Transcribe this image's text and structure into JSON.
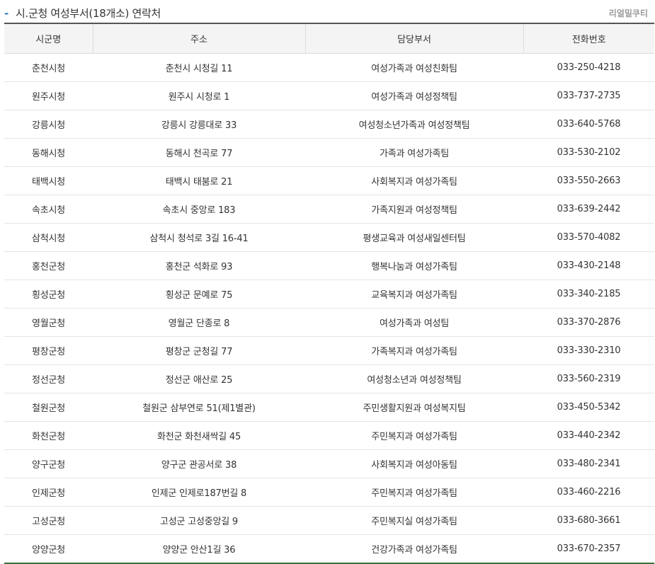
{
  "header": {
    "dash": "-",
    "title": "시.군청 여성부서(18개소) 연락처",
    "watermark": "리얼밀쿠티"
  },
  "table": {
    "columns": [
      "시군명",
      "주소",
      "담당부서",
      "전화번호"
    ],
    "rows": [
      [
        "춘천시청",
        "춘천시 시청길 11",
        "여성가족과 여성친화팀",
        "033-250-4218"
      ],
      [
        "원주시청",
        "원주시 시청로 1",
        "여성가족과 여성정책팀",
        "033-737-2735"
      ],
      [
        "강릉시청",
        "강릉시 강릉대로 33",
        "여성청소년가족과 여성정책팀",
        "033-640-5768"
      ],
      [
        "동해시청",
        "동해시 천곡로 77",
        "가족과 여성가족팀",
        "033-530-2102"
      ],
      [
        "태백시청",
        "태백시 태붐로 21",
        "사회복지과 여성가족팀",
        "033-550-2663"
      ],
      [
        "속초시청",
        "속초시 중앙로 183",
        "가족지원과 여성정책팀",
        "033-639-2442"
      ],
      [
        "삼척시청",
        "삼척시 청석로 3길 16-41",
        "평생교육과 여성새일센터팀",
        "033-570-4082"
      ],
      [
        "홍천군청",
        "홍천군 석화로 93",
        "행복나눔과 여성가족팀",
        "033-430-2148"
      ],
      [
        "횡성군청",
        "횡성군 문예로 75",
        "교육복지과 여성가족팀",
        "033-340-2185"
      ],
      [
        "영월군청",
        "영월군 단종로 8",
        "여성가족과 여성팀",
        "033-370-2876"
      ],
      [
        "평창군청",
        "평창군 군청길 77",
        "가족복지과 여성가족팀",
        "033-330-2310"
      ],
      [
        "정선군청",
        "정선군 애산로 25",
        "여성청소년과 여성정책팀",
        "033-560-2319"
      ],
      [
        "철원군청",
        "철원군 삼부연로 51(제1별관)",
        "주민생활지원과 여성복지팀",
        "033-450-5342"
      ],
      [
        "화천군청",
        "화천군 화천새싹길 45",
        "주민복지과 여성가족팀",
        "033-440-2342"
      ],
      [
        "양구군청",
        "양구군 관공서로 38",
        "사회복지과 여성아동팀",
        "033-480-2341"
      ],
      [
        "인제군청",
        "인제군 인제로187번길 8",
        "주민복지과 여성가족팀",
        "033-460-2216"
      ],
      [
        "고성군청",
        "고성군 고성중앙길 9",
        "주민복지실 여성가족팀",
        "033-680-3661"
      ],
      [
        "양양군청",
        "양양군 안산1길 36",
        "건강가족과 여성가족팀",
        "033-670-2357"
      ]
    ]
  }
}
